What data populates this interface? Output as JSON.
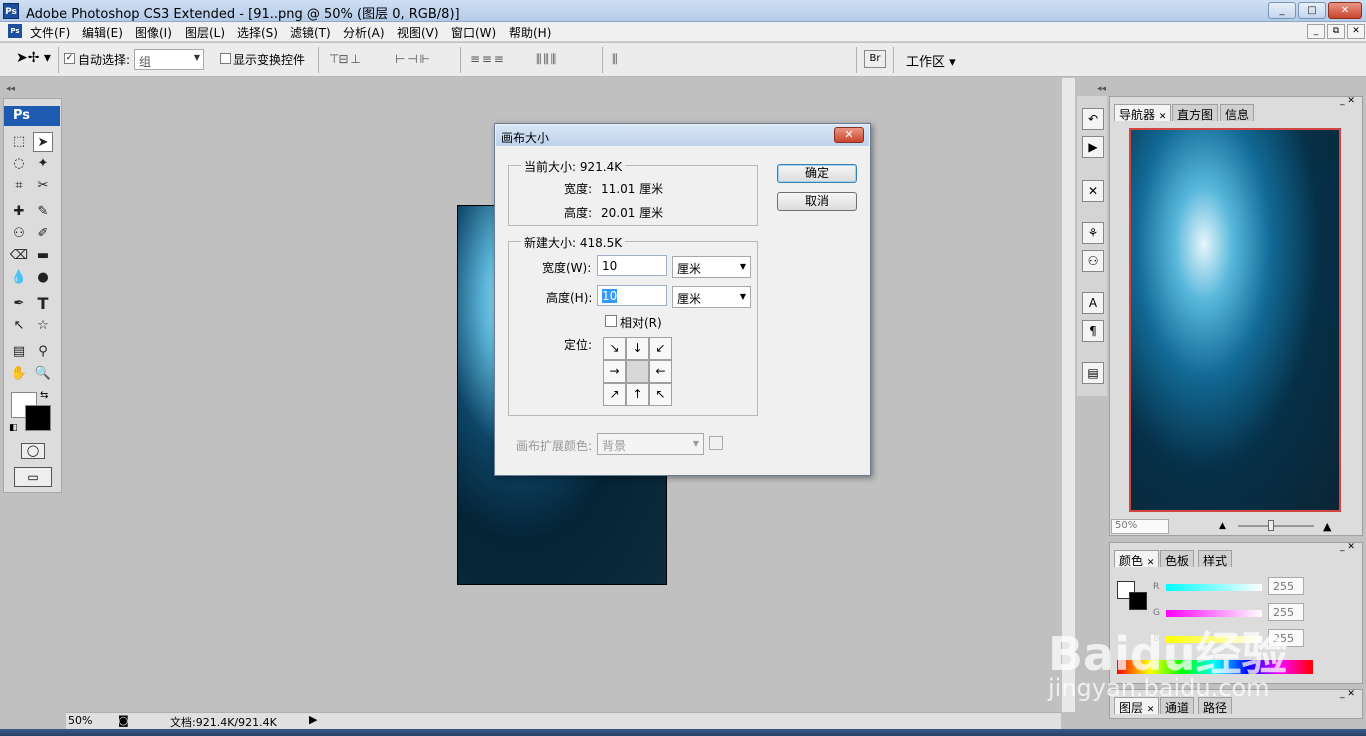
{
  "window": {
    "title": "Adobe Photoshop CS3 Extended - [91..png @ 50% (图层 0, RGB/8)]",
    "app_icon": "Ps",
    "min": "_",
    "max": "□",
    "close": "✕"
  },
  "menu": [
    "文件(F)",
    "编辑(E)",
    "图像(I)",
    "图层(L)",
    "选择(S)",
    "滤镜(T)",
    "分析(A)",
    "视图(V)",
    "窗口(W)",
    "帮助(H)"
  ],
  "doc_icon": "Ps",
  "mdi": {
    "min": "_",
    "restore": "⧉",
    "close": "✕"
  },
  "options": {
    "auto_select_checked": "✓",
    "auto_select_label": "自动选择:",
    "auto_select_value": "组",
    "show_transform_label": "显示变换控件",
    "workspace_label": "工作区 ▾"
  },
  "toolbox": {
    "logo": "Ps"
  },
  "status": {
    "zoom": "50%",
    "doc_size": "文档:921.4K/921.4K"
  },
  "dialog": {
    "title": "画布大小",
    "close": "✕",
    "current_size_label": "当前大小: 921.4K",
    "current_width_label": "宽度:",
    "current_width_value": "11.01 厘米",
    "current_height_label": "高度:",
    "current_height_value": "20.01 厘米",
    "new_size_label": "新建大小: 418.5K",
    "width_label": "宽度(W):",
    "width_value": "10",
    "width_unit": "厘米",
    "height_label": "高度(H):",
    "height_value": "10",
    "height_unit": "厘米",
    "relative_label": "相对(R)",
    "anchor_label": "定位:",
    "anchors": [
      "↘",
      "↓",
      "↙",
      "→",
      "",
      "←",
      "↗",
      "↑",
      "↖"
    ],
    "ext_color_label": "画布扩展颜色:",
    "ext_color_value": "背景",
    "ok": "确定",
    "cancel": "取消"
  },
  "navigator": {
    "tabs": [
      "导航器",
      "直方图",
      "信息"
    ],
    "zoom": "50%"
  },
  "color_panel": {
    "tabs": [
      "颜色",
      "色板",
      "样式"
    ],
    "r_label": "R",
    "g_label": "G",
    "b_label": "B",
    "r": "255",
    "g": "255",
    "b": "255"
  },
  "layers_panel": {
    "tabs": [
      "图层",
      "通道",
      "路径"
    ]
  },
  "watermark": {
    "brand": "Baidu经验",
    "url": "jingyan.baidu.com"
  }
}
